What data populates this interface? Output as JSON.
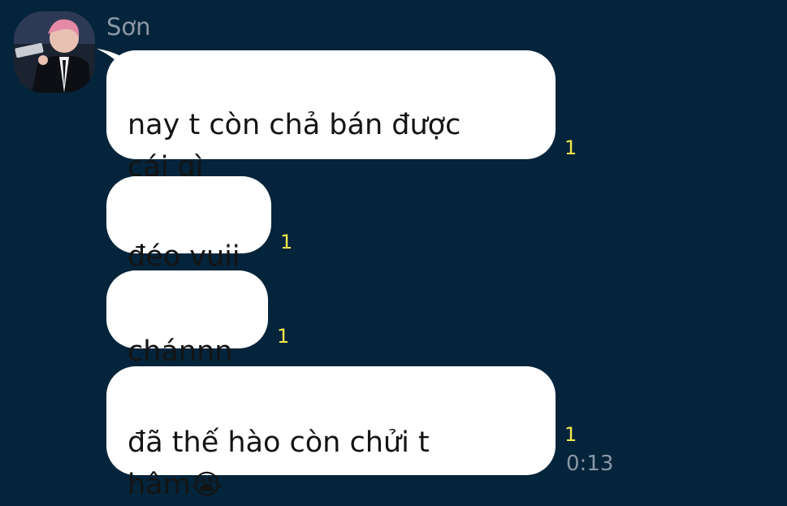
{
  "chat": {
    "sender_name": "Sơn",
    "avatar": {
      "icon": "profile-photo-avatar",
      "colors": {
        "background": "#1b2230",
        "hair": "#e48aa6",
        "suit": "#0d0f14",
        "shirt": "#f2f2f2"
      }
    },
    "messages": [
      {
        "text": "nay t còn chả bán được\ncái gì",
        "unread_count": "1"
      },
      {
        "text": "đéo vuii",
        "unread_count": "1"
      },
      {
        "text": "chánnn",
        "unread_count": "1"
      },
      {
        "text": "đã thế hào còn chửi t\nhâm",
        "emoji": "😭",
        "unread_count": "1",
        "time": "0:13"
      }
    ]
  },
  "colors": {
    "background": "#04243b",
    "bubble": "#ffffff",
    "unread": "#f5e94a",
    "meta_text": "#8b97a5"
  }
}
